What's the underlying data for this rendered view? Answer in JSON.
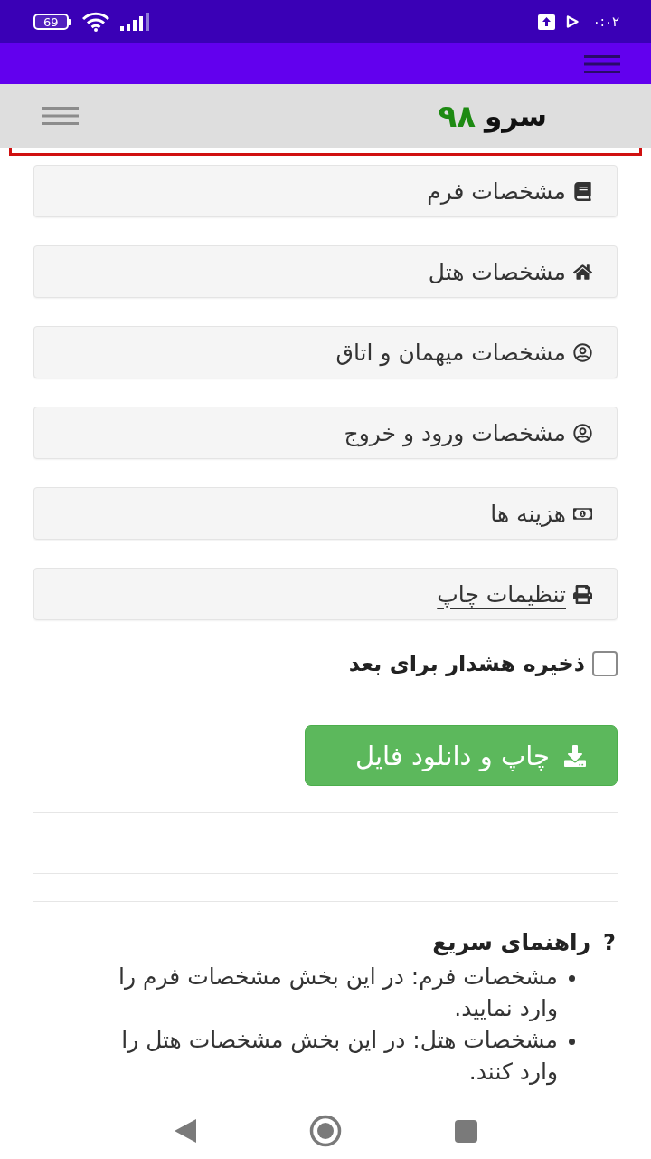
{
  "status_bar": {
    "battery": "69",
    "time": "۰:۰۲"
  },
  "header": {
    "title": "سرو",
    "number": "۹۸"
  },
  "sections": [
    {
      "label": "مشخصات فرم",
      "underlined": false
    },
    {
      "label": "مشخصات هتل",
      "underlined": false
    },
    {
      "label": "مشخصات میهمان و اتاق",
      "underlined": false
    },
    {
      "label": "مشخصات ورود و خروج",
      "underlined": false
    },
    {
      "label": "هزینه ها",
      "underlined": false
    },
    {
      "label": "تنظیمات چاپ",
      "underlined": true
    }
  ],
  "save_alert": {
    "label": "ذخیره هشدار برای بعد",
    "checked": false
  },
  "print_button": {
    "label": "چاپ و دانلود فایل"
  },
  "quick_help": {
    "mark": "?",
    "title": "راهنمای سریع",
    "items": [
      "مشخصات فرم: در این بخش مشخصات فرم را وارد نمایید.",
      "مشخصات هتل: در این بخش مشخصات هتل را وارد کنند."
    ]
  }
}
